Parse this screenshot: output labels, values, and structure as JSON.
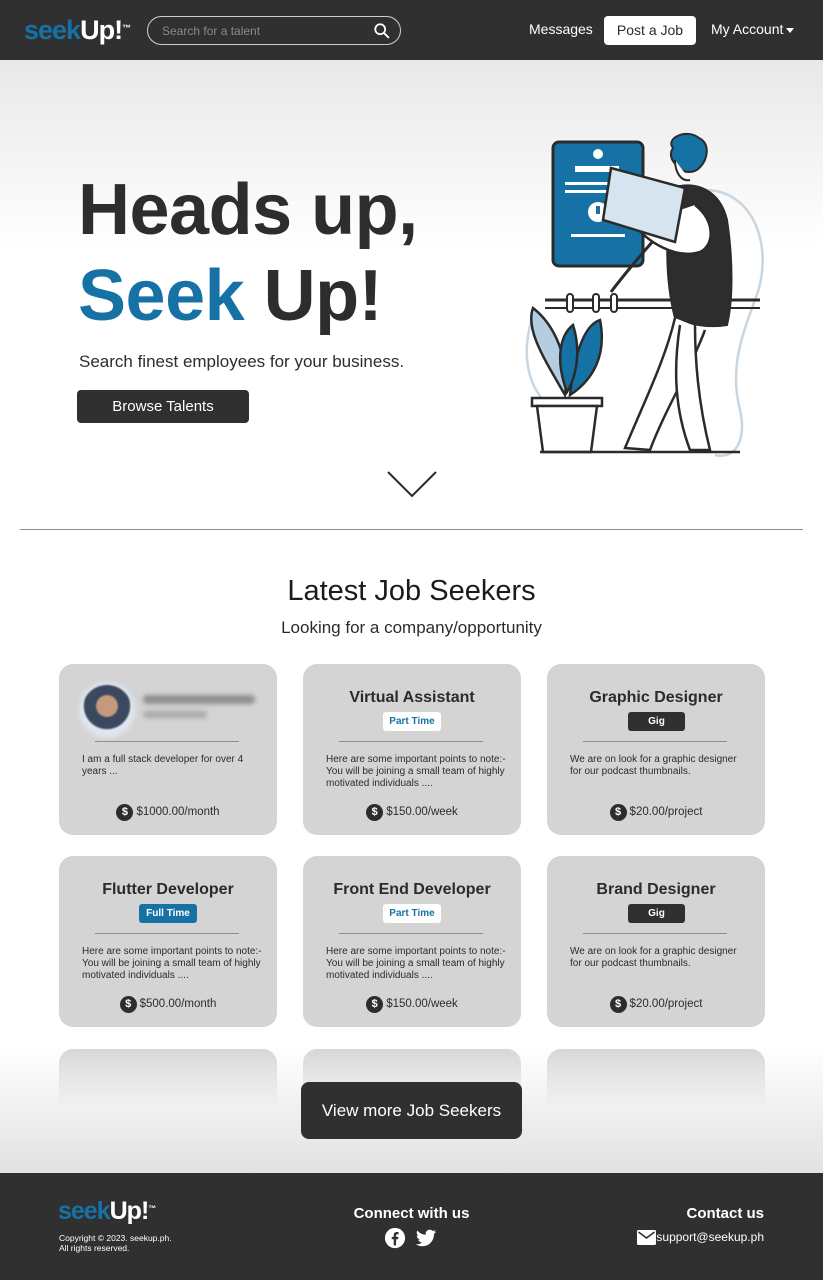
{
  "nav": {
    "logo_seek": "seek",
    "logo_up": "Up!",
    "search_placeholder": "Search for a talent",
    "messages": "Messages",
    "post_job": "Post a Job",
    "account": "My Account"
  },
  "hero": {
    "line1": "Heads up,",
    "line2_blue": "Seek",
    "line2_dark": "Up!",
    "subtitle": "Search finest employees for your business.",
    "cta": "Browse Talents"
  },
  "seekers": {
    "title": "Latest Job Seekers",
    "subtitle": "Looking for a company/opportunity",
    "cards": [
      {
        "title": "",
        "badge": "",
        "desc": "I am a full stack developer for over 4 years ...",
        "price": "$1000.00/month"
      },
      {
        "title": "Virtual Assistant",
        "badge": "Part Time",
        "desc": "Here are some important points to note:-You will be joining a small team of highly motivated individuals ....",
        "price": "$150.00/week"
      },
      {
        "title": "Graphic Designer",
        "badge": "Gig",
        "desc": "We are on look for a graphic designer for our podcast thumbnails.",
        "price": "$20.00/project"
      },
      {
        "title": "Flutter Developer",
        "badge": "Full Time",
        "desc": "Here are some important points to note:-You will be joining a small team of highly motivated individuals ....",
        "price": "$500.00/month"
      },
      {
        "title": "Front End Developer",
        "badge": "Part Time",
        "desc": "Here are some important points to note:-You will be joining a small team of highly motivated individuals ....",
        "price": "$150.00/week"
      },
      {
        "title": "Brand Designer",
        "badge": "Gig",
        "desc": "We are on look for a graphic designer for our podcast thumbnails.",
        "price": "$20.00/project"
      }
    ],
    "view_more": "View more Job Seekers"
  },
  "footer": {
    "logo_seek": "seek",
    "logo_up": "Up!",
    "copyright": "Copyright © 2023. seekup.ph.",
    "rights": "All rights reserved.",
    "connect": "Connect with us",
    "contact": "Contact us",
    "email": "support@seekup.ph"
  },
  "colors": {
    "brand_blue": "#1672a5",
    "dark": "#303030",
    "card_bg": "#d4d4d4"
  }
}
